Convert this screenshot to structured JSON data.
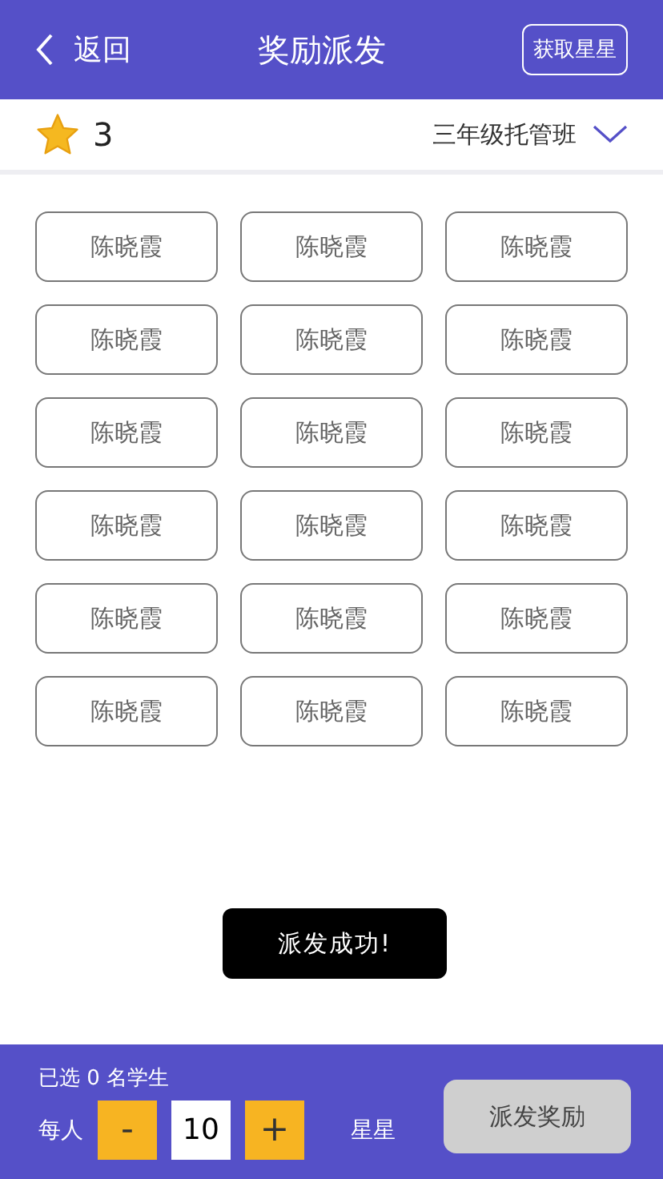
{
  "header": {
    "back_label": "返回",
    "title": "奖励派发",
    "action_label": "获取星星"
  },
  "summary": {
    "stars_count": "3",
    "class_name": "三年级托管班"
  },
  "students": [
    {
      "name": "陈晓霞",
      "selected": false
    },
    {
      "name": "陈晓霞",
      "selected": false
    },
    {
      "name": "陈晓霞",
      "selected": false
    },
    {
      "name": "陈晓霞",
      "selected": false
    },
    {
      "name": "陈晓霞",
      "selected": false
    },
    {
      "name": "陈晓霞",
      "selected": false
    },
    {
      "name": "陈晓霞",
      "selected": false
    },
    {
      "name": "陈晓霞",
      "selected": false
    },
    {
      "name": "陈晓霞",
      "selected": false
    },
    {
      "name": "陈晓霞",
      "selected": false
    },
    {
      "name": "陈晓霞",
      "selected": false
    },
    {
      "name": "陈晓霞",
      "selected": false
    },
    {
      "name": "陈晓霞",
      "selected": false
    },
    {
      "name": "陈晓霞",
      "selected": false
    },
    {
      "name": "陈晓霞",
      "selected": false
    },
    {
      "name": "陈晓霞",
      "selected": false
    },
    {
      "name": "陈晓霞",
      "selected": false
    },
    {
      "name": "陈晓霞",
      "selected": false
    }
  ],
  "toast": "派发成功!",
  "footer": {
    "selected_text": "已选 0 名学生",
    "per_label": "每人",
    "minus": "-",
    "amount": "10",
    "plus": "+",
    "unit": "星星",
    "submit": {
      "label": "派发奖励",
      "disabled": true
    }
  }
}
